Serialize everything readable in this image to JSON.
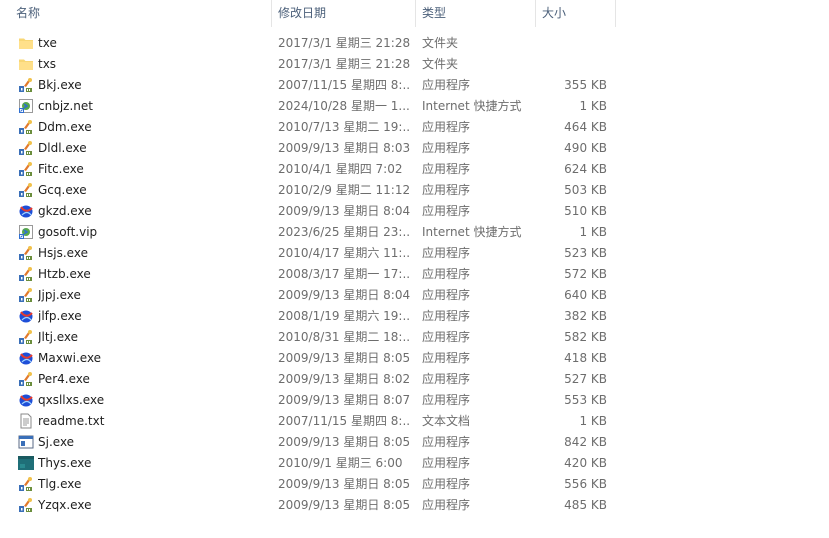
{
  "columns": {
    "name": "名称",
    "date": "修改日期",
    "type": "类型",
    "size": "大小"
  },
  "sort_indicator": "^",
  "files": [
    {
      "name": "txe",
      "date": "2017/3/1 星期三 21:28",
      "type": "文件夹",
      "size": "",
      "icon": "folder-icon"
    },
    {
      "name": "txs",
      "date": "2017/3/1 星期三 21:28",
      "type": "文件夹",
      "size": "",
      "icon": "folder-icon"
    },
    {
      "name": "Bkj.exe",
      "date": "2007/11/15 星期四 8:...",
      "type": "应用程序",
      "size": "355 KB",
      "icon": "app-icon"
    },
    {
      "name": "cnbjz.net",
      "date": "2024/10/28 星期一 1...",
      "type": "Internet 快捷方式",
      "size": "1 KB",
      "icon": "internet-shortcut-icon"
    },
    {
      "name": "Ddm.exe",
      "date": "2010/7/13 星期二 19:...",
      "type": "应用程序",
      "size": "464 KB",
      "icon": "app-icon"
    },
    {
      "name": "Dldl.exe",
      "date": "2009/9/13 星期日 8:03",
      "type": "应用程序",
      "size": "490 KB",
      "icon": "app-icon"
    },
    {
      "name": "Fitc.exe",
      "date": "2010/4/1 星期四 7:02",
      "type": "应用程序",
      "size": "624 KB",
      "icon": "app-icon"
    },
    {
      "name": "Gcq.exe",
      "date": "2010/2/9 星期二 11:12",
      "type": "应用程序",
      "size": "503 KB",
      "icon": "app-icon"
    },
    {
      "name": "gkzd.exe",
      "date": "2009/9/13 星期日 8:04",
      "type": "应用程序",
      "size": "510 KB",
      "icon": "globe-app-icon"
    },
    {
      "name": "gosoft.vip",
      "date": "2023/6/25 星期日 23:...",
      "type": "Internet 快捷方式",
      "size": "1 KB",
      "icon": "internet-shortcut-icon"
    },
    {
      "name": "Hsjs.exe",
      "date": "2010/4/17 星期六 11:...",
      "type": "应用程序",
      "size": "523 KB",
      "icon": "app-icon"
    },
    {
      "name": "Htzb.exe",
      "date": "2008/3/17 星期一 17:...",
      "type": "应用程序",
      "size": "572 KB",
      "icon": "app-icon"
    },
    {
      "name": "Jjpj.exe",
      "date": "2009/9/13 星期日 8:04",
      "type": "应用程序",
      "size": "640 KB",
      "icon": "app-icon"
    },
    {
      "name": "jlfp.exe",
      "date": "2008/1/19 星期六 19:...",
      "type": "应用程序",
      "size": "382 KB",
      "icon": "globe-app-icon"
    },
    {
      "name": "Jltj.exe",
      "date": "2010/8/31 星期二 18:...",
      "type": "应用程序",
      "size": "582 KB",
      "icon": "app-icon"
    },
    {
      "name": "Maxwi.exe",
      "date": "2009/9/13 星期日 8:05",
      "type": "应用程序",
      "size": "418 KB",
      "icon": "globe-app-icon"
    },
    {
      "name": "Per4.exe",
      "date": "2009/9/13 星期日 8:02",
      "type": "应用程序",
      "size": "527 KB",
      "icon": "app-icon"
    },
    {
      "name": "qxsllxs.exe",
      "date": "2009/9/13 星期日 8:07",
      "type": "应用程序",
      "size": "553 KB",
      "icon": "globe-app-icon"
    },
    {
      "name": "readme.txt",
      "date": "2007/11/15 星期四 8:...",
      "type": "文本文档",
      "size": "1 KB",
      "icon": "text-file-icon"
    },
    {
      "name": "Sj.exe",
      "date": "2009/9/13 星期日 8:05",
      "type": "应用程序",
      "size": "842 KB",
      "icon": "window-app-icon"
    },
    {
      "name": "Thys.exe",
      "date": "2010/9/1 星期三 6:00",
      "type": "应用程序",
      "size": "420 KB",
      "icon": "teal-app-icon"
    },
    {
      "name": "Tlg.exe",
      "date": "2009/9/13 星期日 8:05",
      "type": "应用程序",
      "size": "556 KB",
      "icon": "app-icon"
    },
    {
      "name": "Yzqx.exe",
      "date": "2009/9/13 星期日 8:05",
      "type": "应用程序",
      "size": "485 KB",
      "icon": "app-icon"
    }
  ]
}
